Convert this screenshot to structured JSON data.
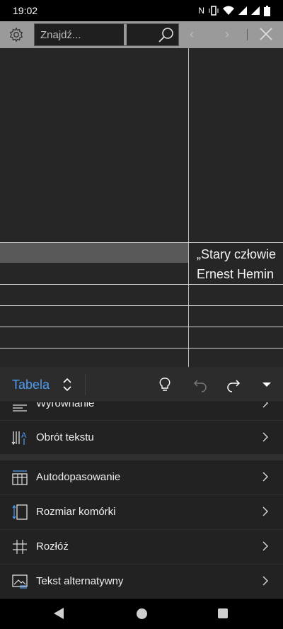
{
  "status_bar": {
    "time": "19:02",
    "icons": [
      "nfc-icon",
      "vibrate-icon",
      "wifi-icon",
      "signal-icon",
      "signal-icon",
      "battery-icon"
    ]
  },
  "find_bar": {
    "search_placeholder": "Znajdź...",
    "icons": [
      "gear-icon",
      "search-icon",
      "chevron-left-icon",
      "chevron-right-icon",
      "close-icon"
    ]
  },
  "document": {
    "cell_lines": [
      "„Stary człowie",
      "Ernest Hemin"
    ]
  },
  "ribbon": {
    "label": "Tabela",
    "accent_color": "#4d9df5"
  },
  "menu": {
    "items": [
      {
        "label": "Wyrównanie",
        "icon": "align-icon"
      },
      {
        "label": "Obrót tekstu",
        "icon": "text-direction-icon"
      },
      {
        "label": "Autodopasowanie",
        "icon": "autofit-icon"
      },
      {
        "label": "Rozmiar komórki",
        "icon": "cell-size-icon"
      },
      {
        "label": "Rozłóż",
        "icon": "distribute-icon"
      },
      {
        "label": "Tekst alternatywny",
        "icon": "alt-text-icon"
      }
    ]
  }
}
